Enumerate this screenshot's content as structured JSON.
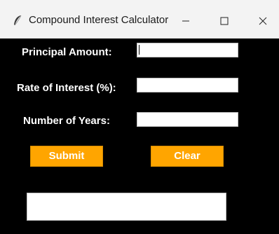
{
  "window": {
    "title": "Compound Interest Calculator",
    "icon": "feather-icon",
    "controls": [
      "minimize-icon",
      "maximize-icon",
      "close-icon"
    ]
  },
  "form": {
    "principal_label": "Principal Amount:",
    "principal_value": "",
    "rate_label": "Rate of Interest (%):",
    "rate_value": "",
    "years_label": "Number of Years:",
    "years_value": ""
  },
  "buttons": {
    "submit_label": "Submit",
    "clear_label": "Clear"
  },
  "result": {
    "value": ""
  },
  "colors": {
    "background": "#000000",
    "button": "#ffa500",
    "button_text": "#ffffff",
    "label_text": "#ffffff"
  }
}
